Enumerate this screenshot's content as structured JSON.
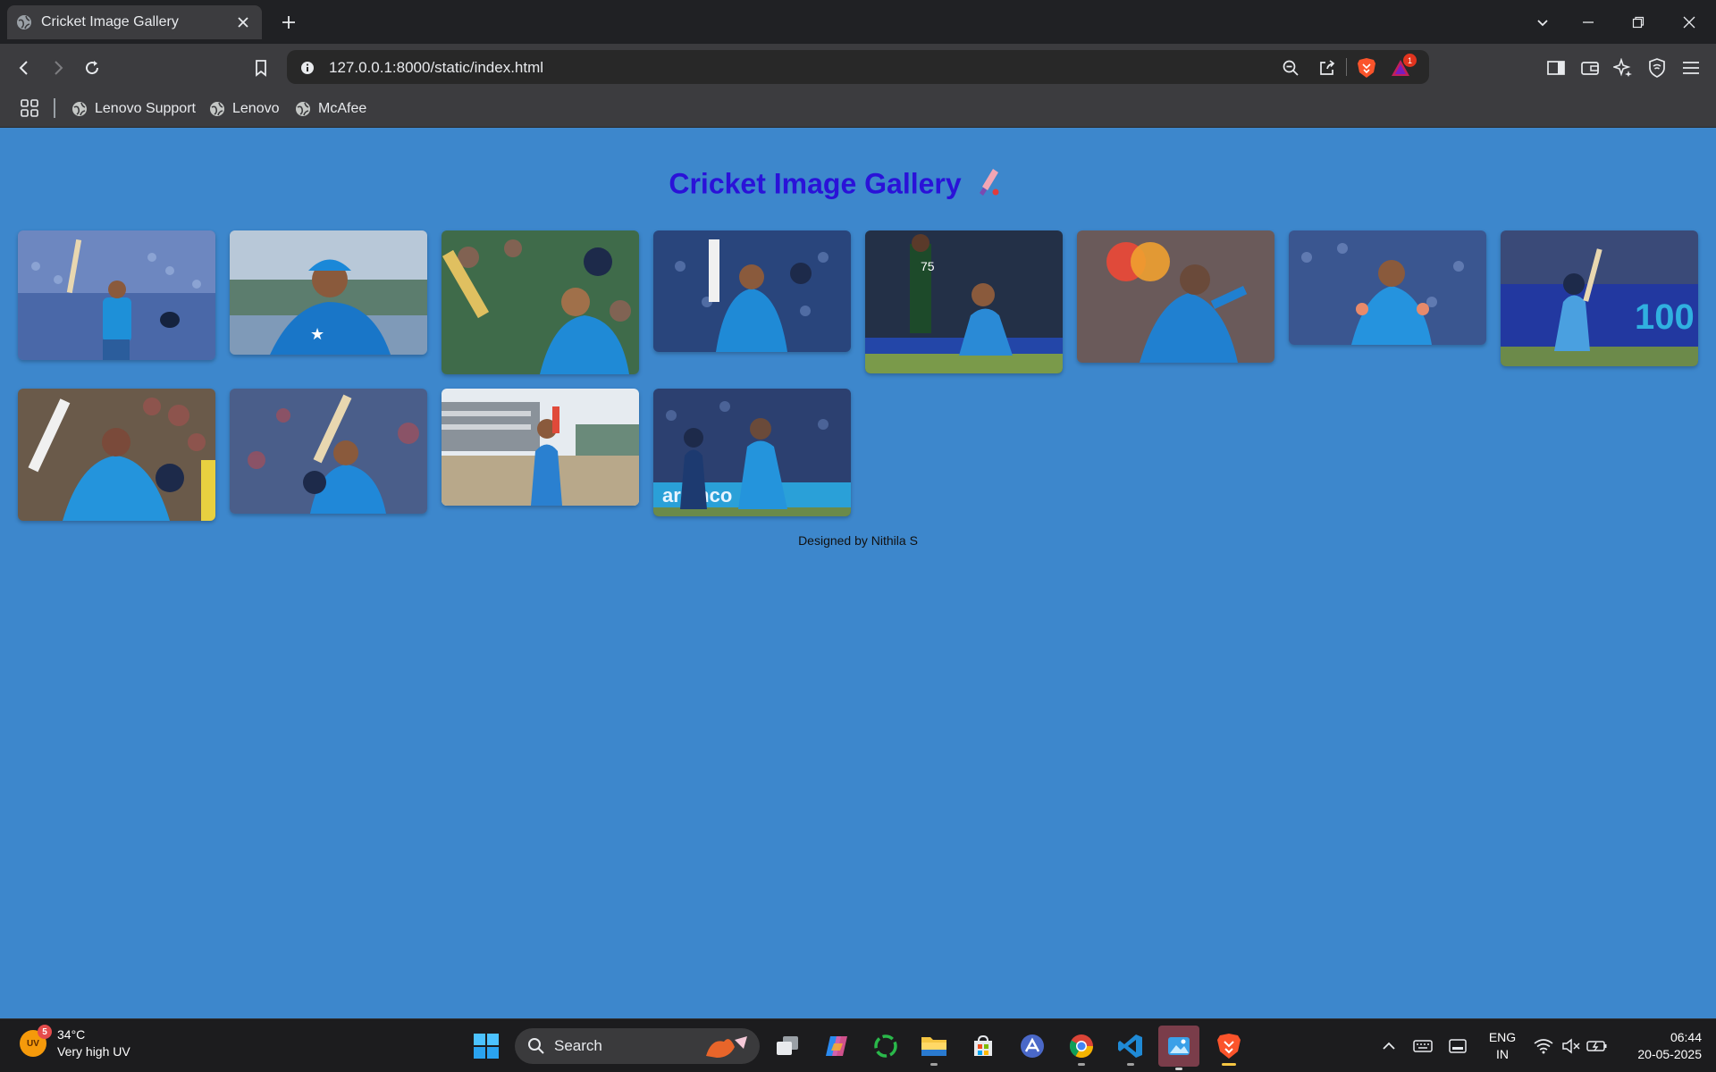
{
  "browser": {
    "tab_title": "Cricket Image Gallery",
    "url": "127.0.0.1:8000/static/index.html",
    "notification_count": "1",
    "bookmarks": [
      "Lenovo Support",
      "Lenovo",
      "McAfee"
    ]
  },
  "page": {
    "title": "Cricket Image Gallery",
    "footer": "Designed by Nithila S",
    "background_color": "#3d87cc",
    "title_color": "#2a12d8",
    "thumbnails": [
      {
        "name": "player-raising-bat-and-helmet"
      },
      {
        "name": "player-in-blue-cap"
      },
      {
        "name": "player-raising-bat-celebration"
      },
      {
        "name": "player-holding-bat-and-helmet"
      },
      {
        "name": "player-kneeling-celebration"
      },
      {
        "name": "player-sword-celebration"
      },
      {
        "name": "bowler-celebrating"
      },
      {
        "name": "batter-walking-after-century"
      },
      {
        "name": "player-raising-bat-crowd"
      },
      {
        "name": "player-raising-bat-helmet-stands"
      },
      {
        "name": "player-celebrating-on-field"
      },
      {
        "name": "bowler-running-celebration"
      }
    ]
  },
  "taskbar": {
    "uv_index": "5",
    "uv_label": "UV",
    "temperature": "34°C",
    "weather_desc": "Very high UV",
    "search_label": "Search",
    "language": "ENG",
    "region": "IN",
    "time": "06:44",
    "date": "20-05-2025"
  }
}
